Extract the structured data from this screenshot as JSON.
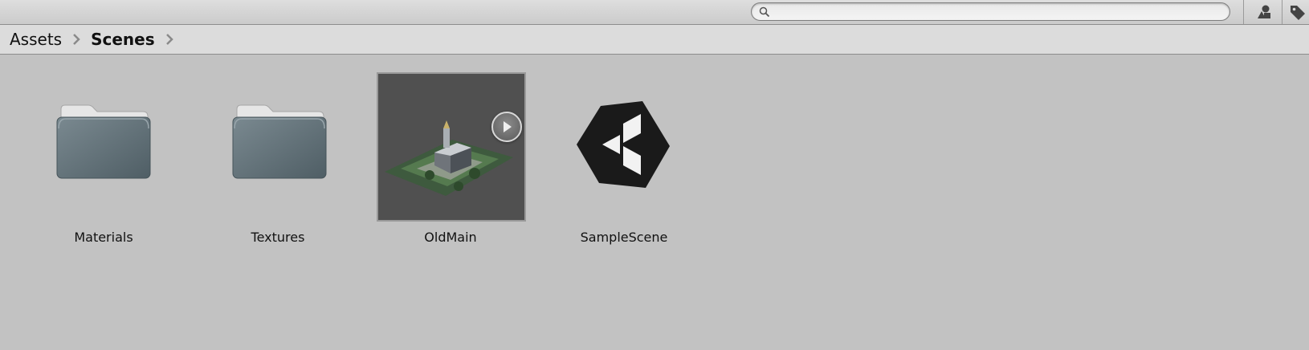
{
  "search": {
    "placeholder": "",
    "value": ""
  },
  "toolbar": {
    "buttons": [
      {
        "icon": "shapes-filter-icon"
      },
      {
        "icon": "tag-icon"
      }
    ]
  },
  "breadcrumb": {
    "items": [
      {
        "label": "Assets",
        "bold": false
      },
      {
        "label": "Scenes",
        "bold": true
      }
    ]
  },
  "assets": [
    {
      "name": "Materials",
      "type": "folder",
      "icon": "folder-icon"
    },
    {
      "name": "Textures",
      "type": "folder",
      "icon": "folder-icon"
    },
    {
      "name": "OldMain",
      "type": "model",
      "icon": "model-preview-thumbnail",
      "selected": true
    },
    {
      "name": "SampleScene",
      "type": "scene",
      "icon": "unity-scene-icon"
    }
  ],
  "colors": {
    "background": "#c2c2c2",
    "breadcrumb_bg": "#dcdcdc",
    "toolbar_bg": "#d4d4d4",
    "folder": "#5f6e75",
    "preview_bg": "#505050"
  }
}
